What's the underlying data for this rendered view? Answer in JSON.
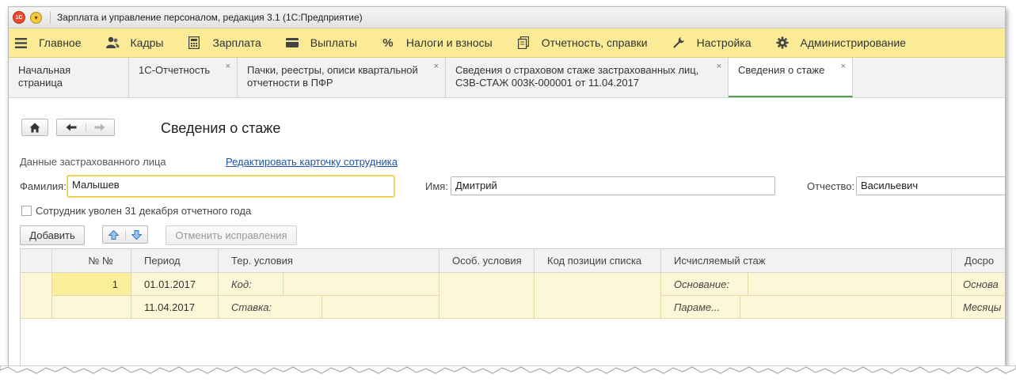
{
  "window": {
    "title": "Зарплата и управление персоналом, редакция 3.1  (1С:Предприятие)"
  },
  "menu": {
    "items": [
      {
        "label": "Главное",
        "icon": "hamburger-icon"
      },
      {
        "label": "Кадры",
        "icon": "people-icon"
      },
      {
        "label": "Зарплата",
        "icon": "calculator-icon"
      },
      {
        "label": "Выплаты",
        "icon": "wallet-icon"
      },
      {
        "label": "Налоги и взносы",
        "icon": "percent-icon"
      },
      {
        "label": "Отчетность, справки",
        "icon": "documents-icon"
      },
      {
        "label": "Настройка",
        "icon": "wrench-icon"
      },
      {
        "label": "Администрирование",
        "icon": "gear-icon"
      }
    ]
  },
  "tabs": [
    {
      "label": "Начальная страница"
    },
    {
      "label": "1С-Отчетность"
    },
    {
      "label": "Пачки, реестры, описи квартальной отчетности в ПФР"
    },
    {
      "label": "Сведения о страховом стаже застрахованных лиц, СЗВ-СТАЖ 003К-000001 от 11.04.2017"
    },
    {
      "label": "Сведения о стаже"
    }
  ],
  "form": {
    "title": "Сведения о стаже",
    "section_label": "Данные застрахованного лица",
    "edit_link": "Редактировать карточку сотрудника",
    "surname_label": "Фамилия:",
    "surname_value": "Малышев",
    "name_label": "Имя:",
    "name_value": "Дмитрий",
    "patronymic_label": "Отчество:",
    "patronymic_value": "Васильевич",
    "dismissed_checkbox_label": "Сотрудник уволен 31 декабря отчетного года",
    "add_button": "Добавить",
    "cancel_corrections_button": "Отменить исправления"
  },
  "table": {
    "headers": [
      "№ №",
      "Период",
      "Тер. условия",
      "Особ. условия",
      "Код позиции списка",
      "Исчисляемый стаж",
      "Досро"
    ],
    "row": {
      "number": "1",
      "period_start": "01.01.2017",
      "period_end": "11.04.2017",
      "ter_code_label": "Код:",
      "ter_rate_label": "Ставка:",
      "stazh_basis_label": "Основание:",
      "stazh_param_label": "Параме...",
      "early_basis_label": "Основа",
      "early_months_label": "Месяцы"
    }
  }
}
